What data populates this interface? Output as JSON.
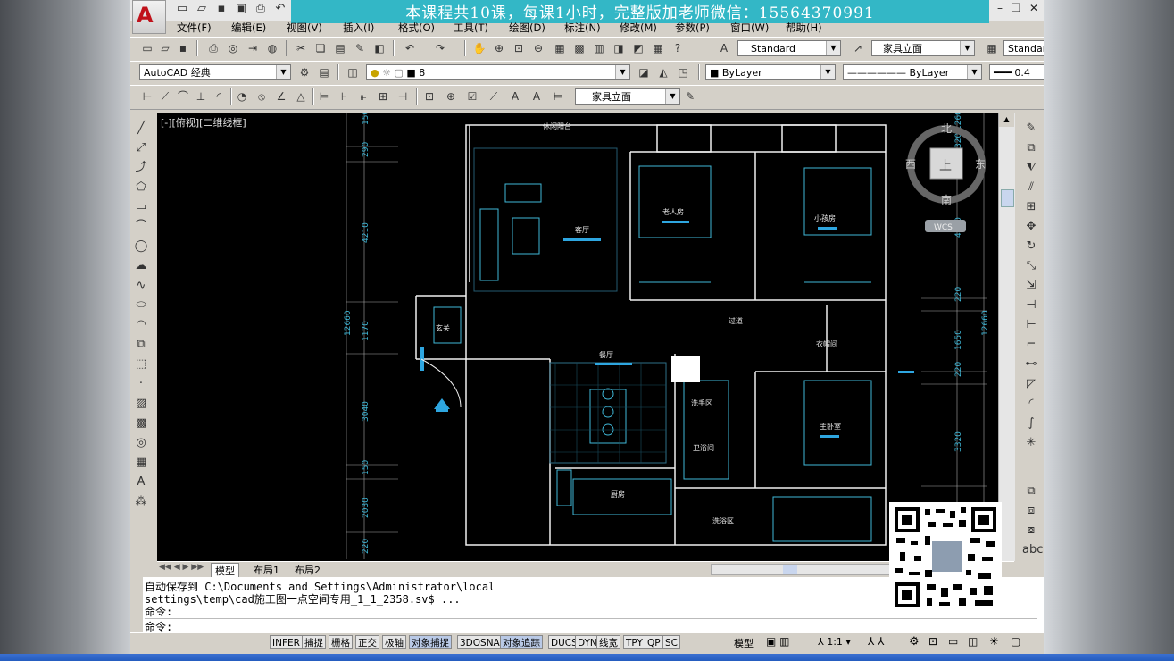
{
  "banner": "本课程共10课，每课1小时，完整版加老师微信：15564370991",
  "menu": [
    "文件(F)",
    "编辑(E)",
    "视图(V)",
    "插入(I)",
    "格式(O)",
    "工具(T)",
    "绘图(D)",
    "标注(N)",
    "修改(M)",
    "参数(P)",
    "窗口(W)",
    "帮助(H)"
  ],
  "toolbar": {
    "text_style": "Standard",
    "dim_style": "家具立面",
    "table_style": "Standar",
    "workspace": "AutoCAD 经典",
    "layer": "8",
    "color": "ByLayer",
    "linetype": "ByLayer",
    "lineweight": "0.4",
    "dim_style2": "家具立面"
  },
  "viewport_label": "[-][俯视][二维线框]",
  "viewcube": {
    "north": "北",
    "south": "南",
    "east": "东",
    "west": "西",
    "top": "上",
    "wcs": "WCS"
  },
  "drawing": {
    "rooms": [
      "休闲阳台",
      "客厅",
      "老人房",
      "小孩房",
      "玄关",
      "过道",
      "衣帽间",
      "餐厅",
      "洗手区",
      "卫浴间",
      "主卧室",
      "厨房",
      "洗浴区"
    ],
    "dims_left": [
      "150",
      "290",
      "4210",
      "1170",
      "3040",
      "150",
      "2030",
      "220"
    ],
    "dims_left_total": "12660",
    "dims_right": [
      "1260",
      "320",
      "4600",
      "220",
      "1650",
      "220",
      "3320"
    ],
    "dims_right_total": "12660"
  },
  "tabs": [
    "模型",
    "布局1",
    "布局2"
  ],
  "command_lines": [
    "自动保存到 C:\\Documents and Settings\\Administrator\\local",
    "settings\\temp\\cad施工图一点空间专用_1_1_2358.sv$ ...",
    "命令:",
    "命令:"
  ],
  "status_buttons": [
    "INFER",
    "捕捉",
    "栅格",
    "正交",
    "极轴",
    "对象捕捉",
    "3DOSNAP",
    "对象追踪",
    "DUCS",
    "DYN",
    "线宽",
    "TPY",
    "QP",
    "SC"
  ],
  "status_right": {
    "model": "模型",
    "scale": "1:1"
  }
}
